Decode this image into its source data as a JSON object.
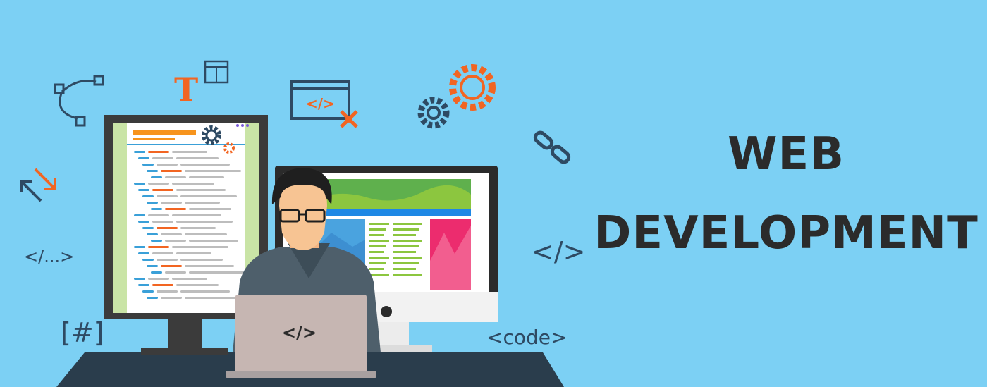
{
  "heading": {
    "line1": "WEB",
    "line2": "DEVELOPMENT"
  },
  "floating_texts": {
    "tag_ellipsis": "</...>",
    "hash": "[#]",
    "code_tag": "<code>",
    "code_brackets": "</>",
    "laptop_code": "</>",
    "window_code": "</>",
    "text_icon": "T"
  },
  "colors": {
    "background": "#7cd0f4",
    "accent_orange": "#f26522",
    "dark_navy": "#2e4a63",
    "text_dark": "#2b2b2b"
  }
}
